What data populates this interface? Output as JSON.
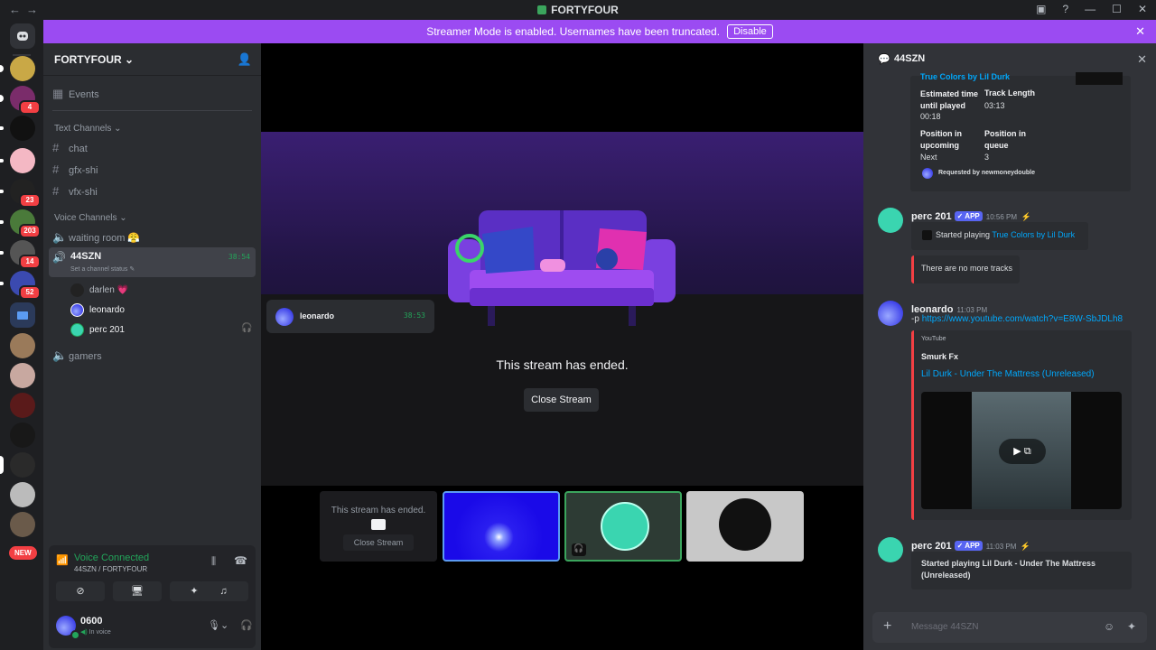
{
  "window": {
    "title": "FORTYFOUR",
    "nav_back": "←",
    "nav_fwd": "→"
  },
  "banner": {
    "text": "Streamer Mode is enabled. Usernames have been truncated.",
    "button": "Disable"
  },
  "servers": {
    "badges": [
      "4",
      "23",
      "203",
      "14",
      "52"
    ],
    "new_label": "NEW"
  },
  "sidebar": {
    "guild_name": "FORTYFOUR",
    "events_label": "Events",
    "text_category": "Text Channels",
    "text_channels": [
      "chat",
      "gfx-shi",
      "vfx-shi"
    ],
    "voice_category": "Voice Channels",
    "voice_waiting": "waiting room",
    "voice_waiting_emoji": "😤",
    "active_voice": {
      "name": "44SZN",
      "timer": "38:54",
      "status_hint": "Set a channel status"
    },
    "voice_users": [
      {
        "name": "darlen",
        "suffix": "💗"
      },
      {
        "name": "leonardo",
        "suffix": ""
      },
      {
        "name": "perc 201",
        "suffix": ""
      }
    ],
    "voice_gamers": "gamers"
  },
  "voice_panel": {
    "status": "Voice Connected",
    "location": "44SZN / FORTYFOUR",
    "user_name": "0600",
    "user_status": "In voice"
  },
  "stage": {
    "ended_text": "This stream has ended.",
    "close_button": "Close Stream",
    "participant_name": "leonardo",
    "participant_timer": "38:53",
    "thumb_ended_text": "This stream has ended.",
    "thumb_close": "Close Stream"
  },
  "chat": {
    "channel": "44SZN",
    "embed1": {
      "track_link": "True Colors by Lil Durk",
      "eta_label": "Estimated time until played",
      "eta_value": "00:18",
      "length_label": "Track Length",
      "length_value": "03:13",
      "pos_upcoming_label": "Position in upcoming",
      "pos_upcoming_value": "Next",
      "pos_queue_label": "Position in queue",
      "pos_queue_value": "3",
      "requested_by": "Requested by newmoneydouble"
    },
    "msg1": {
      "author": "perc 201",
      "badge": "APP",
      "time": "10:56 PM",
      "started_prefix": "Started playing",
      "started_link": "True Colors by Lil Durk",
      "no_more": "There are no more tracks"
    },
    "msg2": {
      "author": "leonardo",
      "time": "11:03 PM",
      "prefix": "-p",
      "url": "https://www.youtube.com/watch?v=E8W-SbJDLh8",
      "provider": "YouTube",
      "channel_name": "Smurk Fx",
      "video_title": "Lil Durk - Under The Mattress (Unreleased)"
    },
    "msg3": {
      "author": "perc 201",
      "badge": "APP",
      "time": "11:03 PM",
      "text": "Started playing Lil Durk - Under The Mattress (Unreleased)"
    },
    "input_placeholder": "Message 44SZN"
  }
}
